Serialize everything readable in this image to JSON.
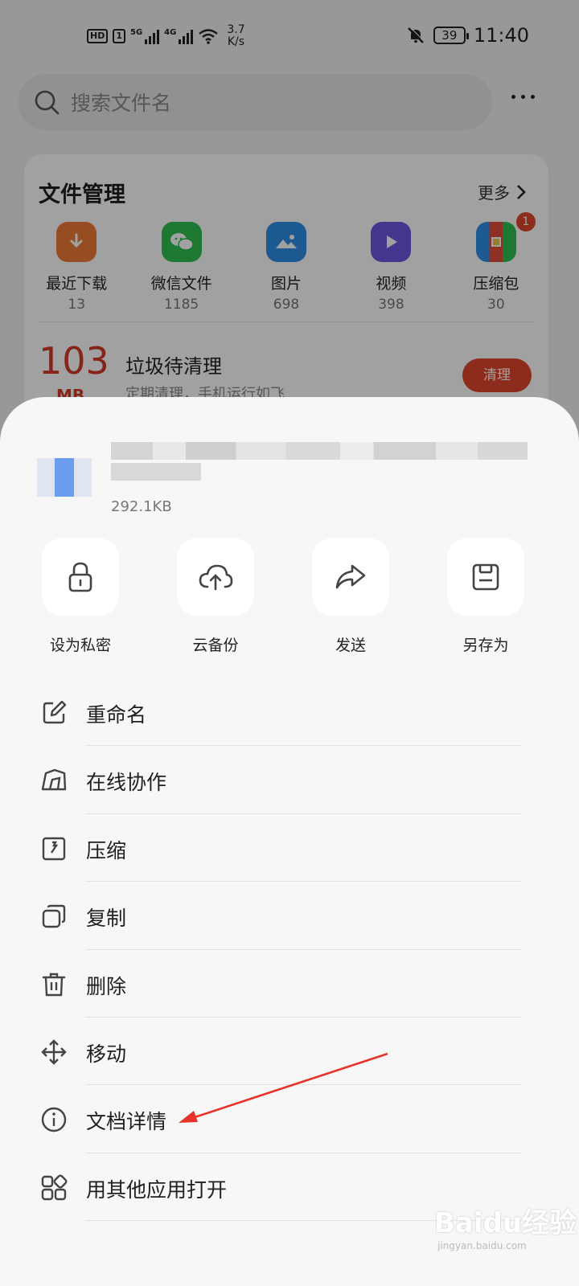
{
  "status_bar": {
    "hd": "HD",
    "sim": "1",
    "net1": "5G",
    "net2": "4G",
    "speed_value": "3.7",
    "speed_unit": "K/s",
    "battery": "39",
    "time": "11:40"
  },
  "search": {
    "placeholder": "搜索文件名"
  },
  "file_manager": {
    "title": "文件管理",
    "more_label": "更多",
    "categories": [
      {
        "label": "最近下载",
        "count": "13",
        "icon": "download-icon",
        "color": "#f07a36"
      },
      {
        "label": "微信文件",
        "count": "1185",
        "icon": "wechat-icon",
        "color": "#2fbf4f"
      },
      {
        "label": "图片",
        "count": "698",
        "icon": "image-icon",
        "color": "#2f8fe8"
      },
      {
        "label": "视频",
        "count": "398",
        "icon": "video-icon",
        "color": "#6a56e0"
      },
      {
        "label": "压缩包",
        "count": "30",
        "icon": "archive-icon",
        "color": "#e34d39",
        "badge": "1"
      }
    ],
    "junk": {
      "size": "103",
      "unit": "MB",
      "title": "垃圾待清理",
      "subtitle": "定期清理，手机运行如飞",
      "button": "清理"
    }
  },
  "sheet": {
    "file_size": "292.1KB",
    "quick_actions": [
      {
        "label": "设为私密",
        "icon": "lock-icon"
      },
      {
        "label": "云备份",
        "icon": "cloud-upload-icon"
      },
      {
        "label": "发送",
        "icon": "share-icon"
      },
      {
        "label": "另存为",
        "icon": "save-icon"
      }
    ],
    "menu": [
      {
        "label": "重命名",
        "icon": "edit-icon"
      },
      {
        "label": "在线协作",
        "icon": "collaborate-icon"
      },
      {
        "label": "压缩",
        "icon": "compress-icon"
      },
      {
        "label": "复制",
        "icon": "copy-icon"
      },
      {
        "label": "删除",
        "icon": "trash-icon"
      },
      {
        "label": "移动",
        "icon": "move-icon"
      },
      {
        "label": "文档详情",
        "icon": "info-icon"
      },
      {
        "label": "用其他应用打开",
        "icon": "apps-icon"
      }
    ]
  },
  "watermark": {
    "main": "Baidu经验",
    "sub": "jingyan.baidu.com"
  },
  "colors": {
    "accent_red": "#e0462d",
    "annotation_arrow": "#e8332a"
  }
}
